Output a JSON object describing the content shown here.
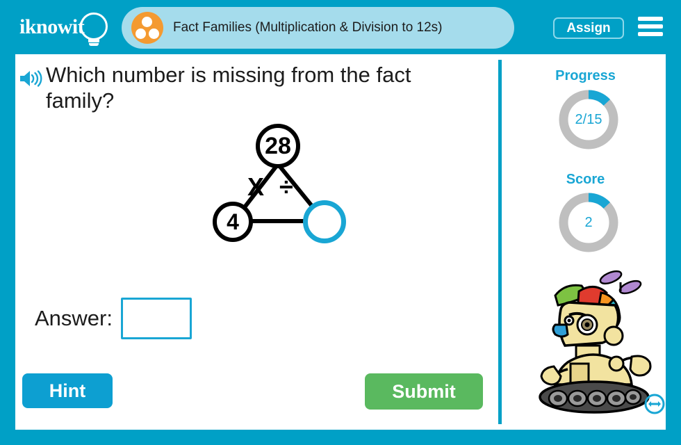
{
  "brand": {
    "logo_text": "iknowit",
    "logo_icon": "lightbulb-icon"
  },
  "header": {
    "title": "Fact Families (Multiplication & Division to 12s)",
    "title_icon": "three-dots-circle-icon",
    "assign_label": "Assign",
    "menu_icon": "hamburger-menu-icon",
    "accent_color": "#00a0c6",
    "pill_color": "#a5dcec",
    "icon_color": "#f49a31"
  },
  "question": {
    "audio_icon": "speaker-icon",
    "text": "Which number is missing from the fact family?"
  },
  "fact_family": {
    "type": "multiplication-division-triangle",
    "top_value": "28",
    "left_value": "4",
    "right_value": "",
    "operators": "X ÷",
    "highlight_color": "#19a6d4"
  },
  "answer": {
    "label": "Answer:",
    "value": "",
    "placeholder": ""
  },
  "actions": {
    "hint_label": "Hint",
    "submit_label": "Submit",
    "hint_color": "#0d9fd1",
    "submit_color": "#5ab95f"
  },
  "sidebar": {
    "progress": {
      "label": "Progress",
      "value": "2/15",
      "completed": 2,
      "total": 15,
      "percent": 13
    },
    "score": {
      "label": "Score",
      "value": "2",
      "percent": 13
    },
    "mascot_icon": "robot-mascot-icon",
    "resize_icon": "resize-horizontal-icon",
    "track_color": "#bfbfbf",
    "arc_color": "#19a6d4"
  }
}
